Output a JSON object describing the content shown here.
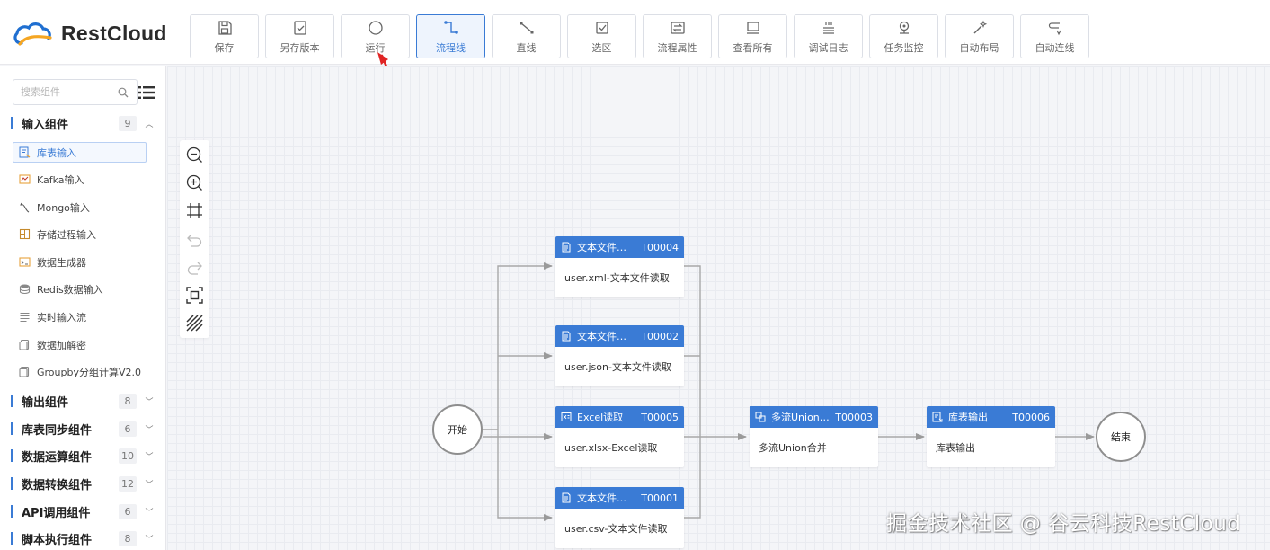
{
  "app": {
    "logo_text": "RestCloud",
    "brand_color": "#3a7bd5"
  },
  "toolbar": [
    {
      "label": "保存",
      "icon": "save-icon",
      "active": false
    },
    {
      "label": "另存版本",
      "icon": "save-version-icon",
      "active": false
    },
    {
      "label": "运行",
      "icon": "run-icon",
      "active": false
    },
    {
      "label": "流程线",
      "icon": "flow-line-icon",
      "active": true
    },
    {
      "label": "直线",
      "icon": "straight-line-icon",
      "active": false
    },
    {
      "label": "选区",
      "icon": "selection-icon",
      "active": false
    },
    {
      "label": "流程属性",
      "icon": "flow-properties-icon",
      "active": false
    },
    {
      "label": "查看所有",
      "icon": "view-all-icon",
      "active": false
    },
    {
      "label": "调试日志",
      "icon": "debug-log-icon",
      "active": false
    },
    {
      "label": "任务监控",
      "icon": "task-monitor-icon",
      "active": false
    },
    {
      "label": "自动布局",
      "icon": "auto-layout-icon",
      "active": false
    },
    {
      "label": "自动连线",
      "icon": "auto-connect-icon",
      "active": false
    }
  ],
  "sidebar": {
    "search_placeholder": "搜索组件",
    "groups": [
      {
        "name": "输入组件",
        "count": "9",
        "expanded": true
      },
      {
        "name": "输出组件",
        "count": "8",
        "expanded": false
      },
      {
        "name": "库表同步组件",
        "count": "6",
        "expanded": false
      },
      {
        "name": "数据运算组件",
        "count": "10",
        "expanded": false
      },
      {
        "name": "数据转换组件",
        "count": "12",
        "expanded": false
      },
      {
        "name": "API调用组件",
        "count": "6",
        "expanded": false
      },
      {
        "name": "脚本执行组件",
        "count": "8",
        "expanded": false
      }
    ],
    "input_components": [
      {
        "name": "库表输入",
        "selected": true
      },
      {
        "name": "Kafka输入",
        "selected": false
      },
      {
        "name": "Mongo输入",
        "selected": false
      },
      {
        "name": "存储过程输入",
        "selected": false
      },
      {
        "name": "数据生成器",
        "selected": false
      },
      {
        "name": "Redis数据输入",
        "selected": false
      },
      {
        "name": "实时输入流",
        "selected": false
      },
      {
        "name": "数据加解密",
        "selected": false
      },
      {
        "name": "Groupby分组计算V2.0",
        "selected": false
      }
    ]
  },
  "flow": {
    "start_label": "开始",
    "end_label": "结束",
    "nodes": [
      {
        "title": "文本文件…",
        "id": "T00004",
        "body": "user.xml-文本文件读取"
      },
      {
        "title": "文本文件…",
        "id": "T00002",
        "body": "user.json-文本文件读取"
      },
      {
        "title": "Excel读取",
        "id": "T00005",
        "body": "user.xlsx-Excel读取"
      },
      {
        "title": "文本文件…",
        "id": "T00001",
        "body": "user.csv-文本文件读取"
      },
      {
        "title": "多流Union…",
        "id": "T00003",
        "body": "多流Union合并"
      },
      {
        "title": "库表输出",
        "id": "T00006",
        "body": "库表输出"
      }
    ]
  },
  "watermark": "掘金技术社区 @ 谷云科技RestCloud"
}
